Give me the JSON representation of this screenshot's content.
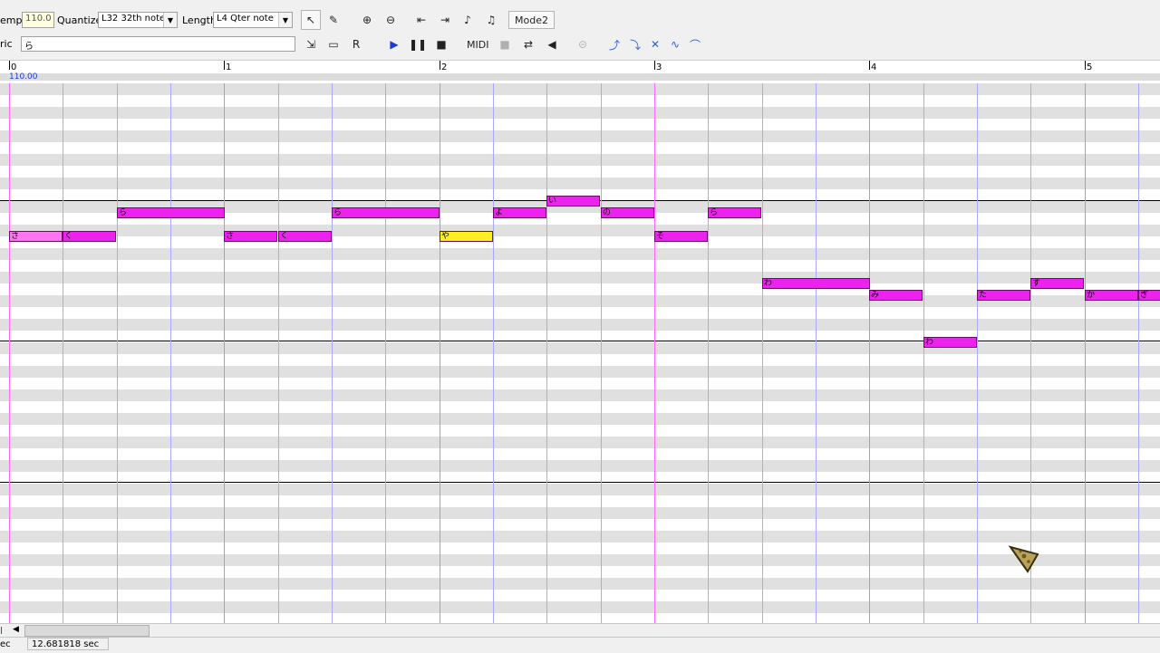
{
  "toolbar": {
    "tempo_label": "empo",
    "tempo_value": "110.0",
    "quantize_label": "Quantize",
    "quantize_value": "L32 32th note",
    "length_label": "Length",
    "length_value": "L4  Qter note",
    "mode_button": "Mode2",
    "lyric_label": "ric",
    "lyric_value": "ら",
    "midi_label": "MIDI",
    "rec_icon_label": "R"
  },
  "ruler": {
    "measures": [
      "0",
      "1",
      "2",
      "3",
      "4",
      "5"
    ],
    "tempo_marker": "110.00"
  },
  "status": {
    "left": "ec",
    "time": "12.681818 sec"
  },
  "notes": [
    {
      "lyric": "さ",
      "start": 0,
      "dur": 1,
      "row": 13,
      "color": "#ff77ee"
    },
    {
      "lyric": "く",
      "start": 1,
      "dur": 1,
      "row": 13,
      "color": "#ee22ee"
    },
    {
      "lyric": "ら",
      "start": 2,
      "dur": 2,
      "row": 11,
      "color": "#ee22ee"
    },
    {
      "lyric": "さ",
      "start": 4,
      "dur": 1,
      "row": 13,
      "color": "#ee22ee"
    },
    {
      "lyric": "く",
      "start": 5,
      "dur": 1,
      "row": 13,
      "color": "#ee22ee"
    },
    {
      "lyric": "ら",
      "start": 6,
      "dur": 2,
      "row": 11,
      "color": "#ee22ee"
    },
    {
      "lyric": "や",
      "start": 8,
      "dur": 1,
      "row": 13,
      "color": "#ffee22"
    },
    {
      "lyric": "よ",
      "start": 9,
      "dur": 1,
      "row": 11,
      "color": "#ee22ee"
    },
    {
      "lyric": "い",
      "start": 10,
      "dur": 1,
      "row": 10,
      "color": "#ee22ee"
    },
    {
      "lyric": "の",
      "start": 11,
      "dur": 1,
      "row": 11,
      "color": "#ee22ee"
    },
    {
      "lyric": "そ",
      "start": 12,
      "dur": 1,
      "row": 13,
      "color": "#ee22ee"
    },
    {
      "lyric": "ら",
      "start": 13,
      "dur": 1,
      "row": 11,
      "color": "#ee22ee"
    },
    {
      "lyric": "わ",
      "start": 14,
      "dur": 2,
      "row": 17,
      "color": "#ee22ee"
    },
    {
      "lyric": "み",
      "start": 16,
      "dur": 1,
      "row": 18,
      "color": "#ee22ee"
    },
    {
      "lyric": "わ",
      "start": 17,
      "dur": 1,
      "row": 22,
      "color": "#ee22ee"
    },
    {
      "lyric": "た",
      "start": 18,
      "dur": 1,
      "row": 18,
      "color": "#ee22ee"
    },
    {
      "lyric": "す",
      "start": 19,
      "dur": 1,
      "row": 17,
      "color": "#ee22ee"
    },
    {
      "lyric": "か",
      "start": 20,
      "dur": 1,
      "row": 18,
      "color": "#ee22ee"
    },
    {
      "lyric": "ぎ",
      "start": 21,
      "dur": 1,
      "row": 18,
      "color": "#ee22ee"
    }
  ],
  "colors": {
    "note": "#ee22ee",
    "note_selected": "#ffee22",
    "measure_line": "#ff66ff",
    "beat_line": "#a9a9ff",
    "row_shade": "#e0e0e0"
  }
}
